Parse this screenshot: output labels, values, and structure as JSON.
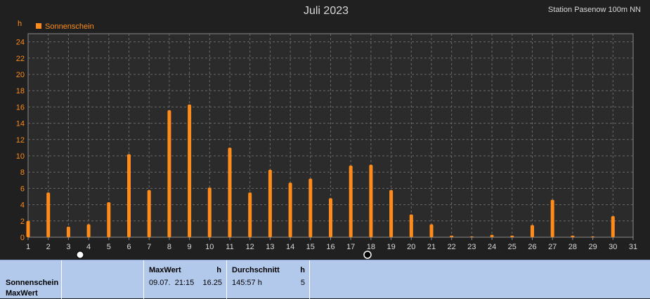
{
  "header": {
    "title": "Juli 2023",
    "station": "Station Pasenow 100m NN"
  },
  "chart_data": {
    "type": "bar",
    "title": "Juli 2023",
    "ylabel": "h",
    "ylim": [
      0,
      25
    ],
    "y_ticks": [
      0,
      2,
      4,
      6,
      8,
      10,
      12,
      14,
      16,
      18,
      20,
      22,
      24
    ],
    "x_ticks": [
      1,
      2,
      3,
      4,
      5,
      6,
      7,
      8,
      9,
      10,
      11,
      12,
      13,
      14,
      15,
      16,
      17,
      18,
      19,
      20,
      21,
      22,
      23,
      24,
      25,
      26,
      27,
      28,
      29,
      30,
      31
    ],
    "grid": true,
    "legend_position": "top-left",
    "colors": {
      "bar": "#ff8c1a",
      "background": "#202020",
      "grid": "#6a6a6a",
      "axis_text": "#d8d8d8",
      "y_text": "#ff8c1a"
    },
    "series": [
      {
        "name": "Sonnenschein",
        "x": [
          1,
          2,
          3,
          4,
          5,
          6,
          7,
          8,
          9,
          10,
          11,
          12,
          13,
          14,
          15,
          16,
          17,
          18,
          19,
          20,
          21,
          22,
          23,
          24,
          25,
          26,
          27,
          28,
          29,
          30
        ],
        "values": [
          2.0,
          5.5,
          1.3,
          1.6,
          4.3,
          10.2,
          5.8,
          15.6,
          16.3,
          6.1,
          11.0,
          5.5,
          8.3,
          6.7,
          7.2,
          4.8,
          8.8,
          8.9,
          5.8,
          2.8,
          1.6,
          0.2,
          0.1,
          0.3,
          0.2,
          1.5,
          4.6,
          0.2,
          0.1,
          2.6
        ]
      }
    ]
  },
  "stats": {
    "row_labels": [
      "Sonnenschein",
      "MaxWert"
    ],
    "max_header": "MaxWert",
    "max_unit": "h",
    "max_time": "09.07.  21:15",
    "max_value": "16.25",
    "avg_header": "Durchschnitt",
    "avg_unit": "h",
    "avg_value": "145:57 h",
    "avg_count": "5"
  }
}
